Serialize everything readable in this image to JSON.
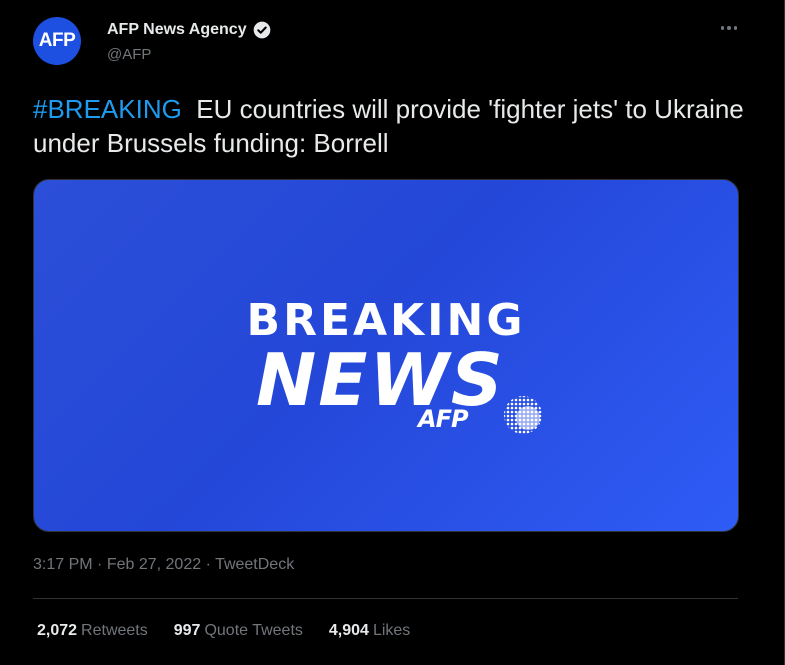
{
  "author": {
    "avatar_text": "AFP",
    "display_name": "AFP News Agency",
    "handle": "@AFP",
    "verified_icon": "verified-badge-icon"
  },
  "tweet": {
    "hashtag": "#BREAKING",
    "text": "EU countries will provide 'fighter jets' to Ukraine under Brussels funding: Borrell",
    "media": {
      "line1": "BREAKING",
      "line2": "NEWS",
      "logo_text": "AFP"
    },
    "time": "3:17 PM",
    "date": "Feb 27, 2022",
    "source": "TweetDeck",
    "sep": "·"
  },
  "stats": {
    "retweets_count": "2,072",
    "retweets_label": "Retweets",
    "quotes_count": "997",
    "quotes_label": "Quote Tweets",
    "likes_count": "4,904",
    "likes_label": "Likes"
  },
  "colors": {
    "background": "#000000",
    "hashtag": "#1d9bf0",
    "avatar": "#1d4fe0",
    "media_blue": "#2c4fd8"
  }
}
